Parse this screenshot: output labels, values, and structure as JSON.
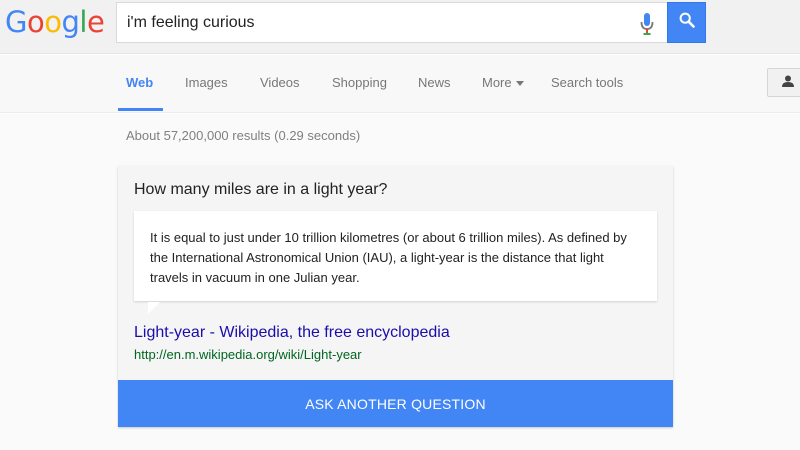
{
  "logo": {
    "letters": [
      {
        "char": "G",
        "color": "#4285f4"
      },
      {
        "char": "o",
        "color": "#ea4335"
      },
      {
        "char": "o",
        "color": "#fbbc05"
      },
      {
        "char": "g",
        "color": "#4285f4"
      },
      {
        "char": "l",
        "color": "#34a853"
      },
      {
        "char": "e",
        "color": "#ea4335"
      }
    ]
  },
  "search": {
    "value": "i'm feeling curious"
  },
  "tabs": [
    {
      "label": "Web"
    },
    {
      "label": "Images"
    },
    {
      "label": "Videos"
    },
    {
      "label": "Shopping"
    },
    {
      "label": "News"
    },
    {
      "label": "More"
    },
    {
      "label": "Search tools"
    }
  ],
  "results": {
    "stats": "About 57,200,000 results (0.29 seconds)"
  },
  "answer": {
    "question": "How many miles are in a light year?",
    "text": "It is equal to just under 10 trillion kilometres (or about 6 trillion miles). As defined by the International Astronomical Union (IAU), a light-year is the distance that light travels in vacuum in one Julian year.",
    "link_title": "Light-year - Wikipedia, the free encyclopedia",
    "url": "http://en.m.wikipedia.org/wiki/Light-year",
    "ask_button": "ASK ANOTHER QUESTION"
  },
  "colors": {
    "accent": "#4285f4",
    "link": "#1a0dab",
    "url": "#006621"
  },
  "icons": {
    "mic": "mic-icon",
    "search": "search-icon",
    "account": "account-icon",
    "more": "chevron-down-icon"
  }
}
